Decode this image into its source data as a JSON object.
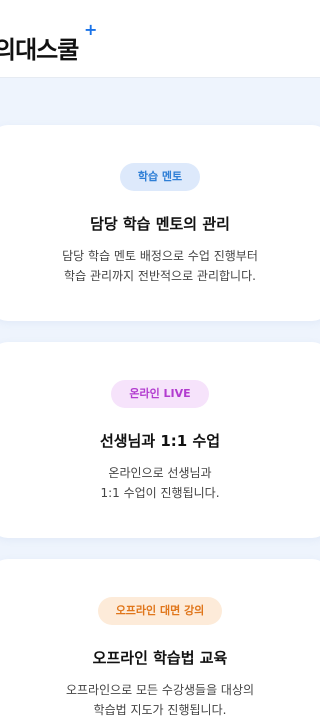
{
  "header": {
    "logo_text": "의대스쿨",
    "logo_plus": "+"
  },
  "cards": [
    {
      "badge": "학습 멘토",
      "title": "담당 학습 멘토의 관리",
      "desc_line1": "담당 학습 멘토 배정으로 수업 진행부터",
      "desc_line2": "학습 관리까지 전반적으로 관리합니다."
    },
    {
      "badge": "온라인 LIVE",
      "title": "선생님과 1:1 수업",
      "desc_line1": "온라인으로 선생님과",
      "desc_line2": "1:1 수업이 진행됩니다."
    },
    {
      "badge": "오프라인 대면 강의",
      "title": "오프라인 학습법 교육",
      "desc_line1": "오프라인으로 모든 수강생들을 대상의",
      "desc_line2": "학습법 지도가 진행됩니다."
    }
  ],
  "colors": {
    "background": "#eef4fd",
    "brand_accent": "#1a73e8",
    "badge_blue": "#2f7fd6",
    "badge_purple": "#b23ccf",
    "badge_orange": "#e0761b"
  }
}
